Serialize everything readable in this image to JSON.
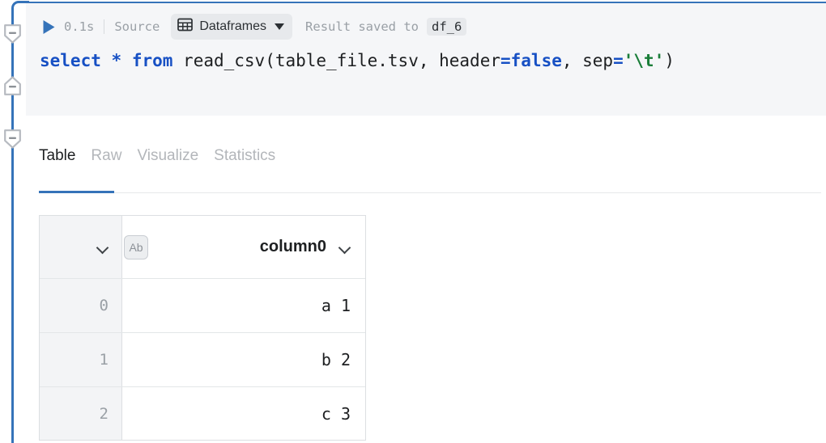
{
  "cell": {
    "run_icon": "play-icon",
    "duration": "0.1s",
    "source_label": "Source",
    "dataframes_icon": "table-grid-icon",
    "dataframes_label": "Dataframes",
    "dropdown_icon": "chevron-down-icon",
    "result_label": "Result saved to",
    "result_variable": "df_6",
    "code": {
      "tokens": [
        {
          "t": "select",
          "k": "kw"
        },
        {
          "t": " ",
          "k": "plain"
        },
        {
          "t": "*",
          "k": "kw"
        },
        {
          "t": " ",
          "k": "plain"
        },
        {
          "t": "from",
          "k": "kw"
        },
        {
          "t": " read_csv(table_file.tsv, header",
          "k": "plain"
        },
        {
          "t": "=",
          "k": "op-blue"
        },
        {
          "t": "false",
          "k": "op-blue"
        },
        {
          "t": ", sep",
          "k": "plain"
        },
        {
          "t": "=",
          "k": "op-blue"
        },
        {
          "t": "'",
          "k": "str-q"
        },
        {
          "t": "\\t",
          "k": "str"
        },
        {
          "t": "'",
          "k": "str-q"
        },
        {
          "t": ")",
          "k": "plain"
        }
      ],
      "plain_text": "select * from read_csv(table_file.tsv, header=false, sep='\\t')"
    }
  },
  "gutter": {
    "folds": [
      {
        "name": "fold-marker-1",
        "direction": "down"
      },
      {
        "name": "fold-marker-2",
        "direction": "up"
      },
      {
        "name": "fold-marker-3",
        "direction": "down"
      }
    ]
  },
  "tabs": [
    {
      "label": "Table",
      "active": true
    },
    {
      "label": "Raw",
      "active": false
    },
    {
      "label": "Visualize",
      "active": false
    },
    {
      "label": "Statistics",
      "active": false
    }
  ],
  "table": {
    "index_header_icon": "chevron-down-icon",
    "column_type_badge": "Ab",
    "column_header": "column0",
    "column_menu_icon": "chevron-down-icon",
    "rows": [
      {
        "index": "0",
        "column0": "a 1"
      },
      {
        "index": "1",
        "column0": "b 2"
      },
      {
        "index": "2",
        "column0": "c 3"
      }
    ]
  },
  "colors": {
    "accent": "#3573b9",
    "keyword": "#1750c4",
    "string": "#197d38",
    "cell_bg": "#f5f6f8",
    "muted_text": "#9aa0a6"
  }
}
